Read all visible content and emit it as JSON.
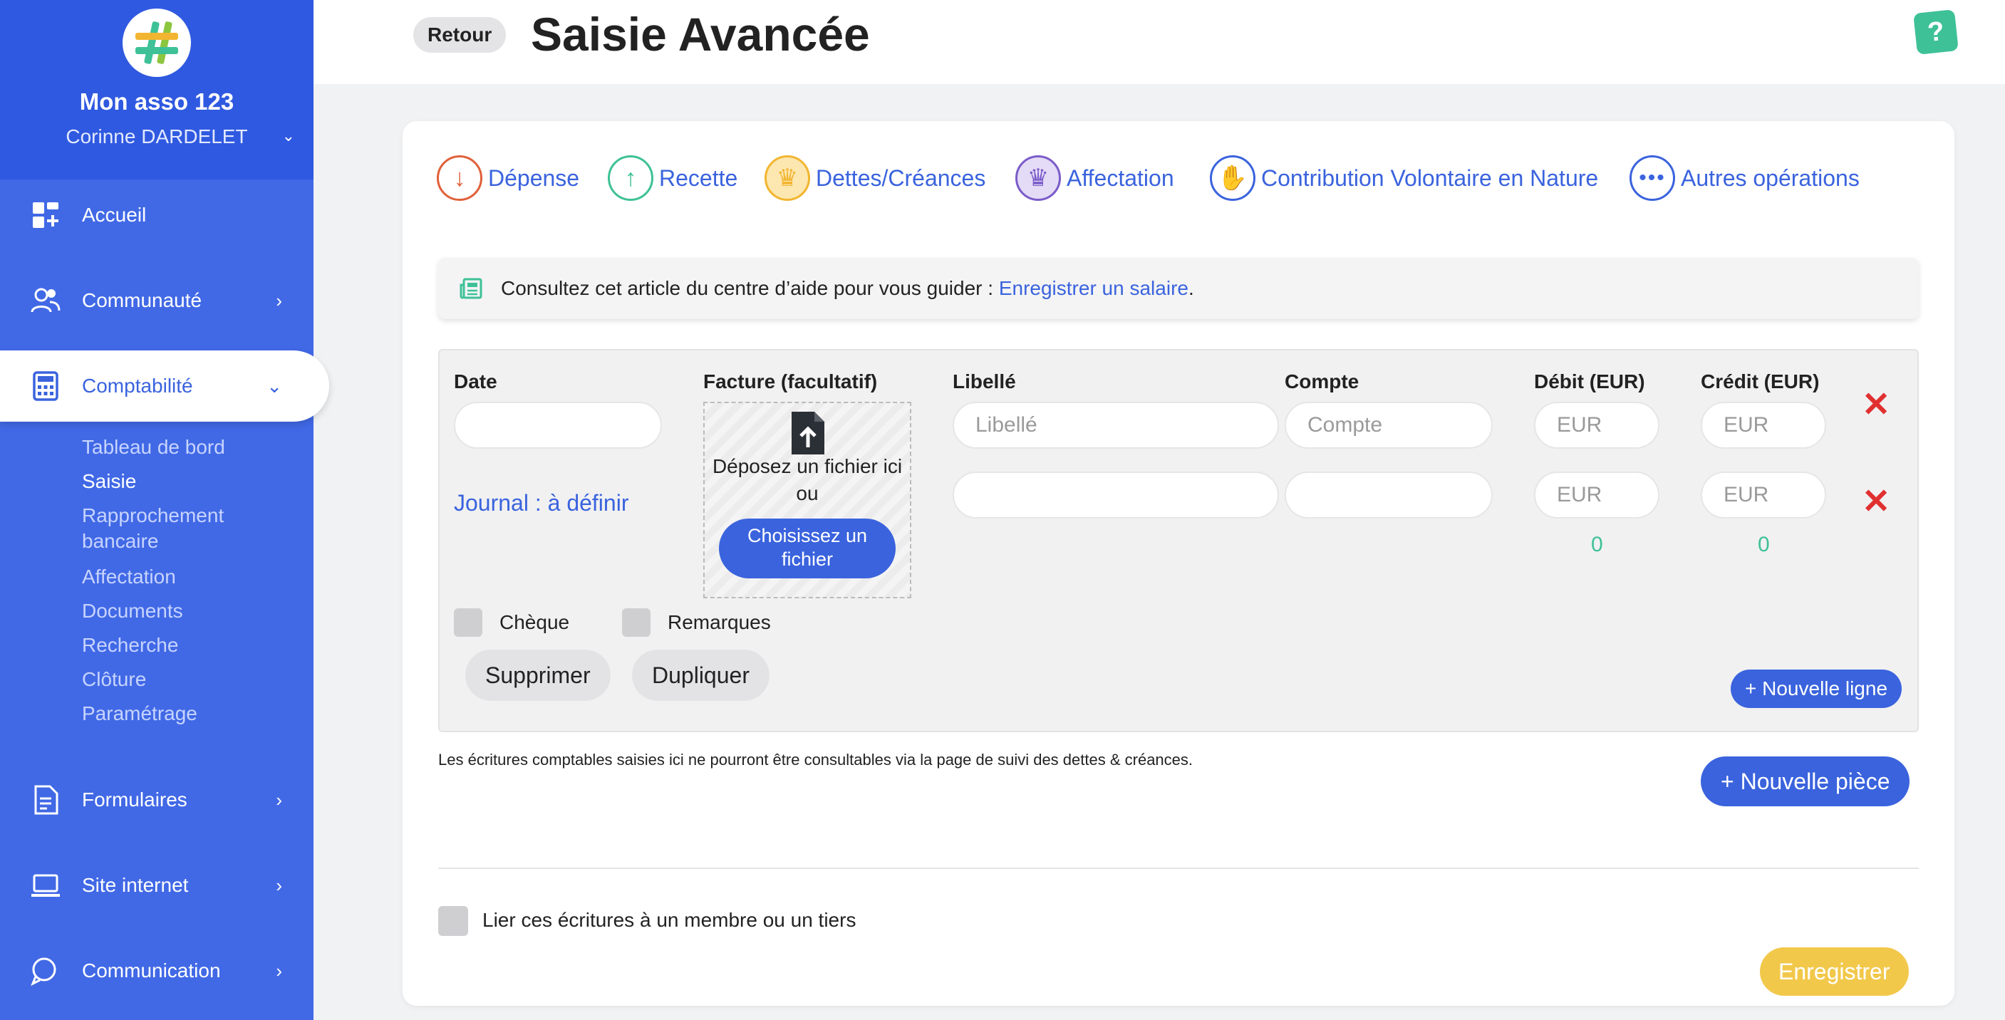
{
  "sidebar": {
    "org_name": "Mon asso 123",
    "user_name": "Corinne DARDELET",
    "nav": [
      {
        "label": "Accueil"
      },
      {
        "label": "Communauté"
      },
      {
        "label": "Comptabilité"
      },
      {
        "label": "Formulaires"
      },
      {
        "label": "Site internet"
      },
      {
        "label": "Communication"
      }
    ],
    "sub_items": [
      "Tableau de bord",
      "Saisie",
      "Rapprochement",
      "bancaire",
      "Affectation",
      "Documents",
      "Recherche",
      "Clôture",
      "Paramétrage"
    ],
    "selected_sub": "Saisie"
  },
  "header": {
    "back_label": "Retour",
    "title": "Saisie Avancée",
    "help_label": "?"
  },
  "op_types": [
    {
      "label": "Dépense",
      "icon": "arrow-down-icon",
      "color": "#e0603a"
    },
    {
      "label": "Recette",
      "icon": "arrow-up-icon",
      "color": "#3ec197"
    },
    {
      "label": "Dettes/Créances",
      "icon": "crown-icon",
      "color": "#f2b531"
    },
    {
      "label": "Affectation",
      "icon": "crown-arrows-icon",
      "color": "#7b5cc9"
    },
    {
      "label": "Contribution Volontaire en Nature",
      "icon": "hand-icon",
      "color": "#3a63dd"
    },
    {
      "label": "Autres opérations",
      "icon": "more-dots-icon",
      "color": "#3a63dd"
    }
  ],
  "help_banner": {
    "text": "Consultez cet article du centre d’aide pour vous guider : ",
    "link": "Enregistrer un salaire",
    "suffix": "."
  },
  "entry": {
    "headers": {
      "date": "Date",
      "invoice": "Facture (facultatif)",
      "label": "Libellé",
      "account": "Compte",
      "debit": "Débit (EUR)",
      "credit": "Crédit (EUR)"
    },
    "placeholders": {
      "label": "Libellé",
      "account": "Compte",
      "debit": "EUR",
      "credit": "EUR"
    },
    "dropzone_text_1": "Déposez un fichier ici",
    "dropzone_text_2": "ou",
    "choose_file_1": "Choisissez un",
    "choose_file_2": "fichier",
    "journal": "Journal : à définir",
    "total_debit": "0",
    "total_credit": "0",
    "cheque_label": "Chèque",
    "remarks_label": "Remarques",
    "delete_label": "Supprimer",
    "duplicate_label": "Dupliquer",
    "new_line_label": "+ Nouvelle ligne",
    "delete_row_icon": "✕"
  },
  "footer": {
    "note": "Les écritures comptables saisies ici ne pourront être consultables via la page de suivi des dettes & créances.",
    "new_piece_label": "+ Nouvelle pièce",
    "link_label": "Lier ces écritures à un membre ou un tiers",
    "save_label": "Enregistrer"
  },
  "colors": {
    "sidebar": "#4169e6",
    "accent": "#3a63dd",
    "save": "#f2c84b",
    "delete": "#e03030",
    "help": "#3ec197"
  }
}
